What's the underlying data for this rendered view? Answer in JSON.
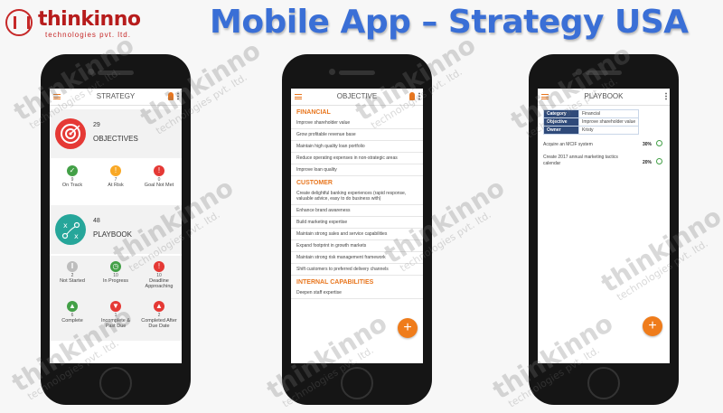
{
  "brand": {
    "name": "thinkinno",
    "tagline": "technologies pvt. ltd.",
    "red": "#c62828"
  },
  "headline": "Mobile App – Strategy USA",
  "colors": {
    "accent": "#e8761e",
    "headline": "#3a6fd6",
    "green": "#43a047",
    "red": "#e53935",
    "yellow": "#fbc02d"
  },
  "watermark": {
    "brand": "thinkinno",
    "tagline": "technologies pvt. ltd."
  },
  "strategy": {
    "title": "STRATEGY",
    "objectives": {
      "count": "29",
      "label": "OBJECTIVES",
      "icon": "target-icon"
    },
    "objective_status": [
      {
        "count": "9",
        "label": "On Track",
        "color": "#43a047",
        "icon": "check-icon"
      },
      {
        "count": "7",
        "label": "At Risk",
        "color": "#f9a825",
        "icon": "alert-icon"
      },
      {
        "count": "0",
        "label": "Goal Not Met",
        "color": "#e53935",
        "icon": "warning-icon"
      }
    ],
    "playbook": {
      "count": "48",
      "label": "PLAYBOOK",
      "icon": "strategy-board-icon"
    },
    "playbook_status": [
      {
        "count": "2",
        "label": "Not Started",
        "color": "#bdbdbd",
        "icon": "pause-icon"
      },
      {
        "count": "10",
        "label": "In Progress",
        "color": "#43a047",
        "icon": "clock-icon"
      },
      {
        "count": "10",
        "label": "Deadline Approaching",
        "color": "#e53935",
        "icon": "warning-icon"
      },
      {
        "count": "6",
        "label": "Complete",
        "color": "#43a047",
        "icon": "thumbs-up-icon"
      },
      {
        "count": "1",
        "label": "Incomplete & Past Due",
        "color": "#e53935",
        "icon": "thumbs-down-icon"
      },
      {
        "count": "2",
        "label": "Completed After Due Date",
        "color": "#e53935",
        "icon": "thumbs-up-icon"
      }
    ]
  },
  "objective_screen": {
    "title": "OBJECTIVE",
    "sections": [
      {
        "name": "FINANCIAL",
        "items": [
          "Improve shareholder value",
          "Grow profitable revenue base",
          "Maintain high quality loan portfolio",
          "Reduce operating expenses in non-strategic areas",
          "Improve loan quality"
        ]
      },
      {
        "name": "CUSTOMER",
        "items": [
          "Create delightful banking experiences (rapid response, valuable advice, easy to do business with)",
          "Enhance brand awareness",
          "Build marketing expertise",
          "Maintain strong sales and service capabilities",
          "Expand footprint in growth markets",
          "Maintain strong risk management framework",
          "Shift customers to preferred delivery channels"
        ]
      },
      {
        "name": "INTERNAL CAPABILITIES",
        "items": [
          "Deepen staff expertise"
        ]
      }
    ],
    "fab": "+"
  },
  "playbook_screen": {
    "title": "PLAYBOOK",
    "meta": [
      {
        "key": "Category",
        "value": "Financial"
      },
      {
        "key": "Objective",
        "value": "Improve shareholder value"
      },
      {
        "key": "Owner",
        "value": "Kristy"
      }
    ],
    "items": [
      {
        "text": "Acquire an MCIF system",
        "progress": "30%"
      },
      {
        "text": "Create 2017 annual marketing tactics calendar",
        "progress": "20%"
      }
    ],
    "fab": "+"
  }
}
